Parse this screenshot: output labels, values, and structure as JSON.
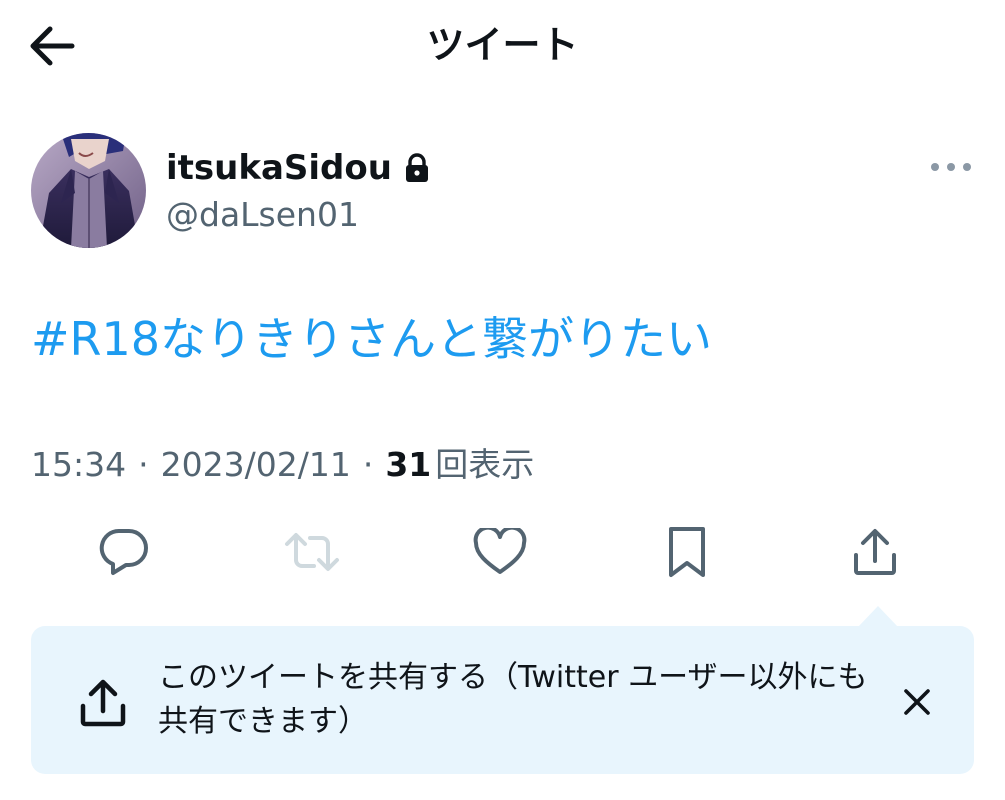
{
  "header": {
    "title": "ツイート",
    "back_icon": "arrow-left-icon"
  },
  "author": {
    "display_name": "itsukaSidou",
    "handle": "@daLsen01",
    "protected_icon": "lock-icon",
    "more_icon": "more-dots-icon"
  },
  "tweet": {
    "text": "#R18なりきりさんと繋がりたい",
    "time": "15:34",
    "date": "2023/02/11",
    "separator": "·",
    "views_count": "31",
    "views_label": "回表示"
  },
  "actions": [
    {
      "name": "reply",
      "icon": "reply-icon",
      "enabled": true
    },
    {
      "name": "retweet",
      "icon": "retweet-icon",
      "enabled": false
    },
    {
      "name": "like",
      "icon": "heart-icon",
      "enabled": true
    },
    {
      "name": "bookmark",
      "icon": "bookmark-icon",
      "enabled": true
    },
    {
      "name": "share",
      "icon": "share-icon",
      "enabled": true
    }
  ],
  "share_tooltip": {
    "text": "このツイートを共有する（Twitter ユーザー以外にも共有できます）",
    "icon": "share-icon",
    "close_icon": "close-icon"
  },
  "colors": {
    "link_blue": "#1d9bf0",
    "text_primary": "#0f1419",
    "text_secondary": "#536471",
    "icon_gray": "#536471",
    "disabled_gray": "#cfd9de",
    "tooltip_bg": "#e8f5fd"
  }
}
